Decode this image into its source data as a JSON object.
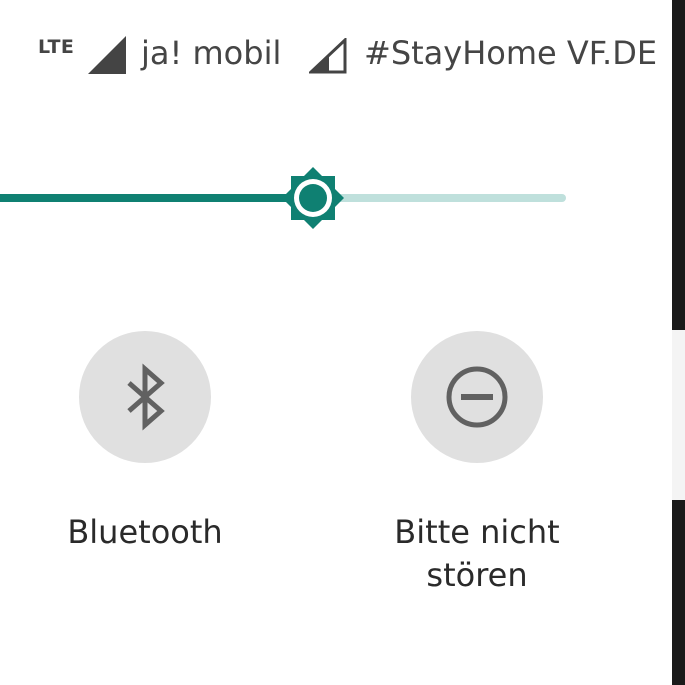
{
  "status_bar": {
    "network_type": "LTE",
    "carrier_1": "ja! mobil",
    "carrier_2": "#StayHome VF.DE"
  },
  "brightness": {
    "level": 0.54,
    "icon": "brightness-icon"
  },
  "tiles": [
    {
      "label": "Bluetooth",
      "icon": "bluetooth-icon"
    },
    {
      "label_line1": "Bitte nicht",
      "label_line2": "stören",
      "icon": "do-not-disturb-icon"
    }
  ],
  "colors": {
    "accent": "#0f8072",
    "track_empty": "#bfe0dc",
    "tile_bg": "#e0e0e0",
    "icon_gray": "#616161"
  }
}
